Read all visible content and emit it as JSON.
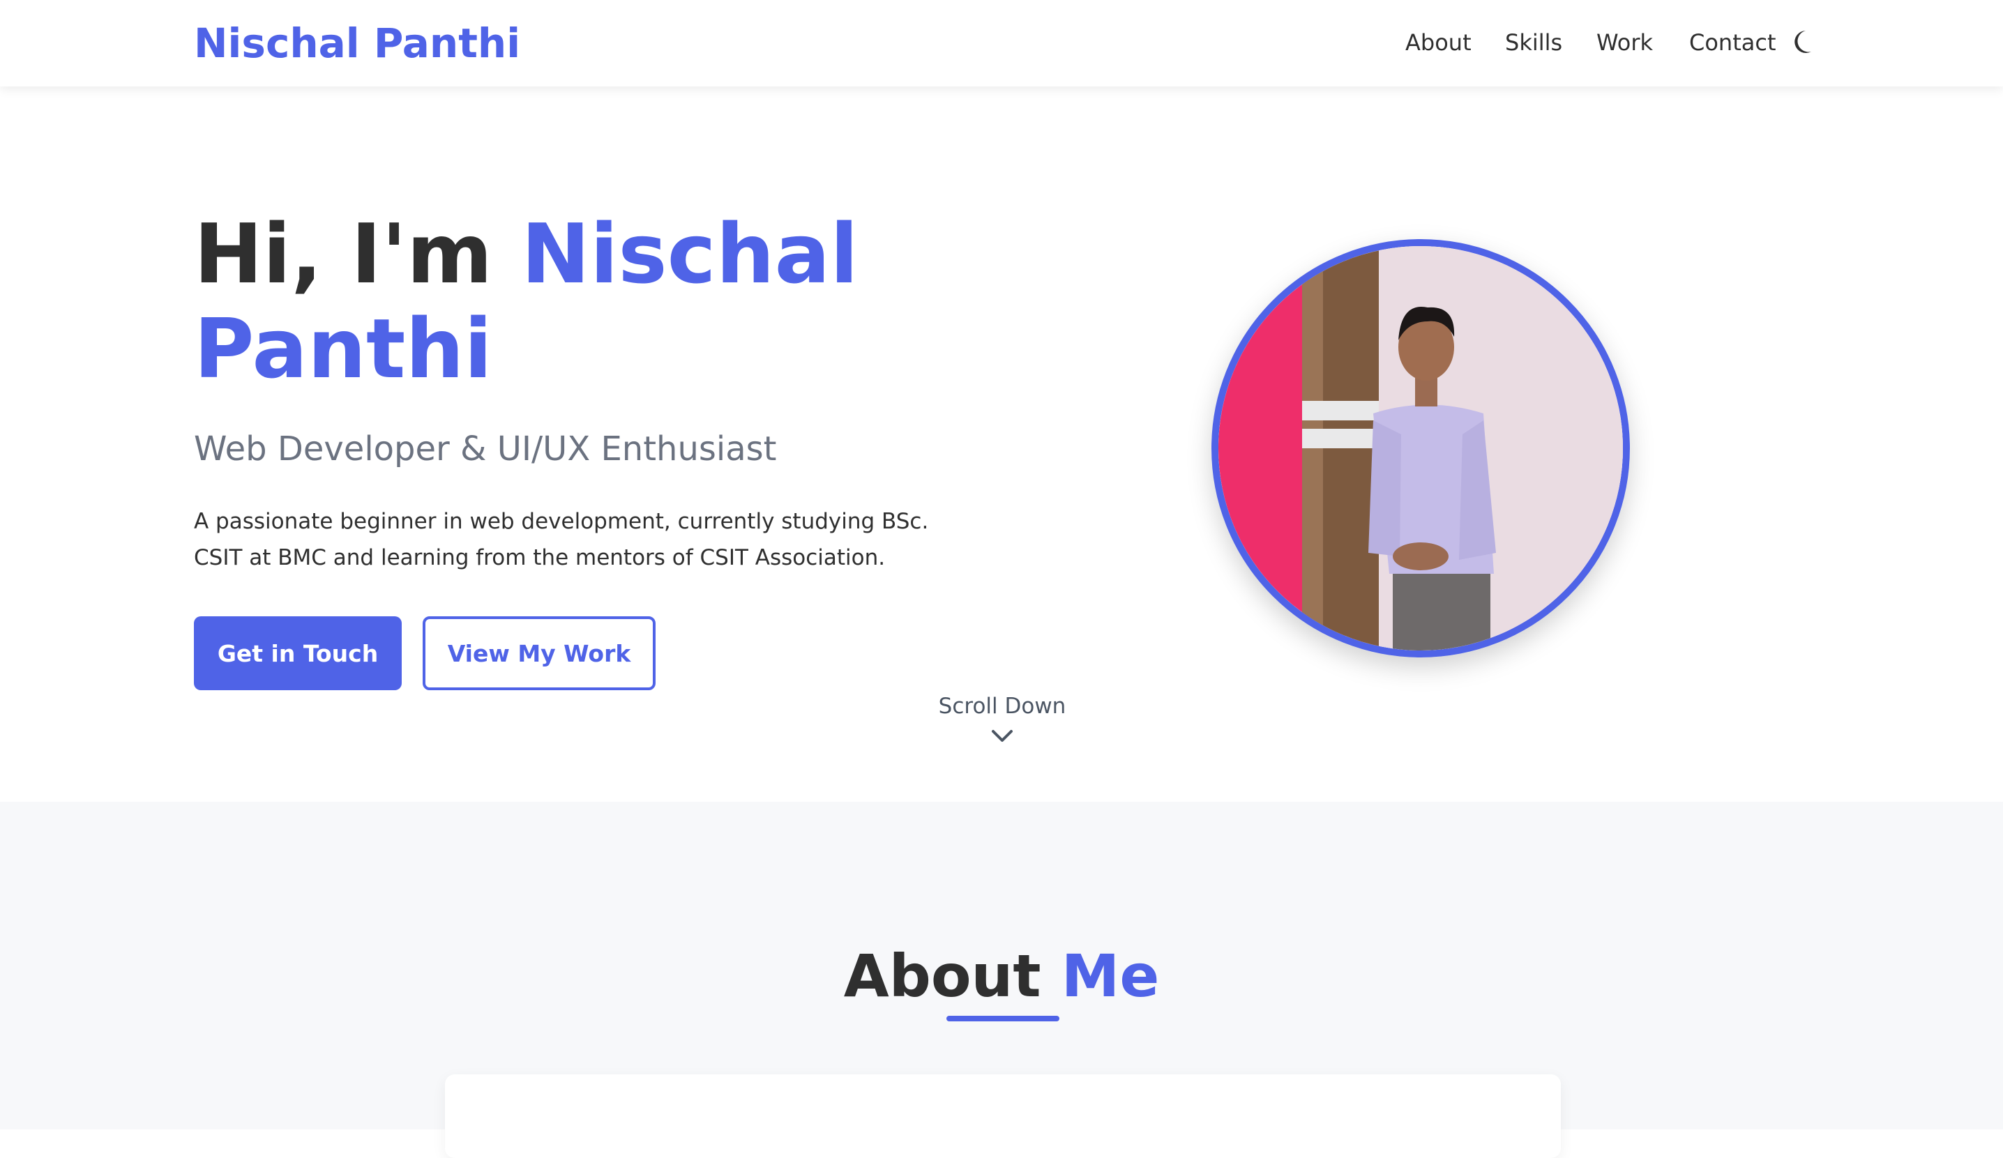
{
  "header": {
    "logo": "Nischal Panthi",
    "nav": [
      "About",
      "Skills",
      "Work",
      "Contact"
    ],
    "theme_toggle_icon": "moon-icon"
  },
  "hero": {
    "greeting": "Hi, I'm ",
    "name_part1": "Nischal",
    "name_part2": "Panthi",
    "subtitle": "Web Developer & UI/UX Enthusiast",
    "description": "A passionate beginner in web development, currently studying BSc. CSIT at BMC and learning from the mentors of CSIT Association.",
    "primary_button": "Get in Touch",
    "secondary_button": "View My Work",
    "scroll_label": "Scroll Down",
    "scroll_icon": "chevron-down-icon",
    "profile_image": "profile-photo"
  },
  "about": {
    "title_part1": "About ",
    "title_part2": "Me"
  },
  "colors": {
    "accent": "#4f63e7",
    "text": "#2f2f2f",
    "muted": "#6b7280",
    "section_bg": "#f7f8fa"
  }
}
